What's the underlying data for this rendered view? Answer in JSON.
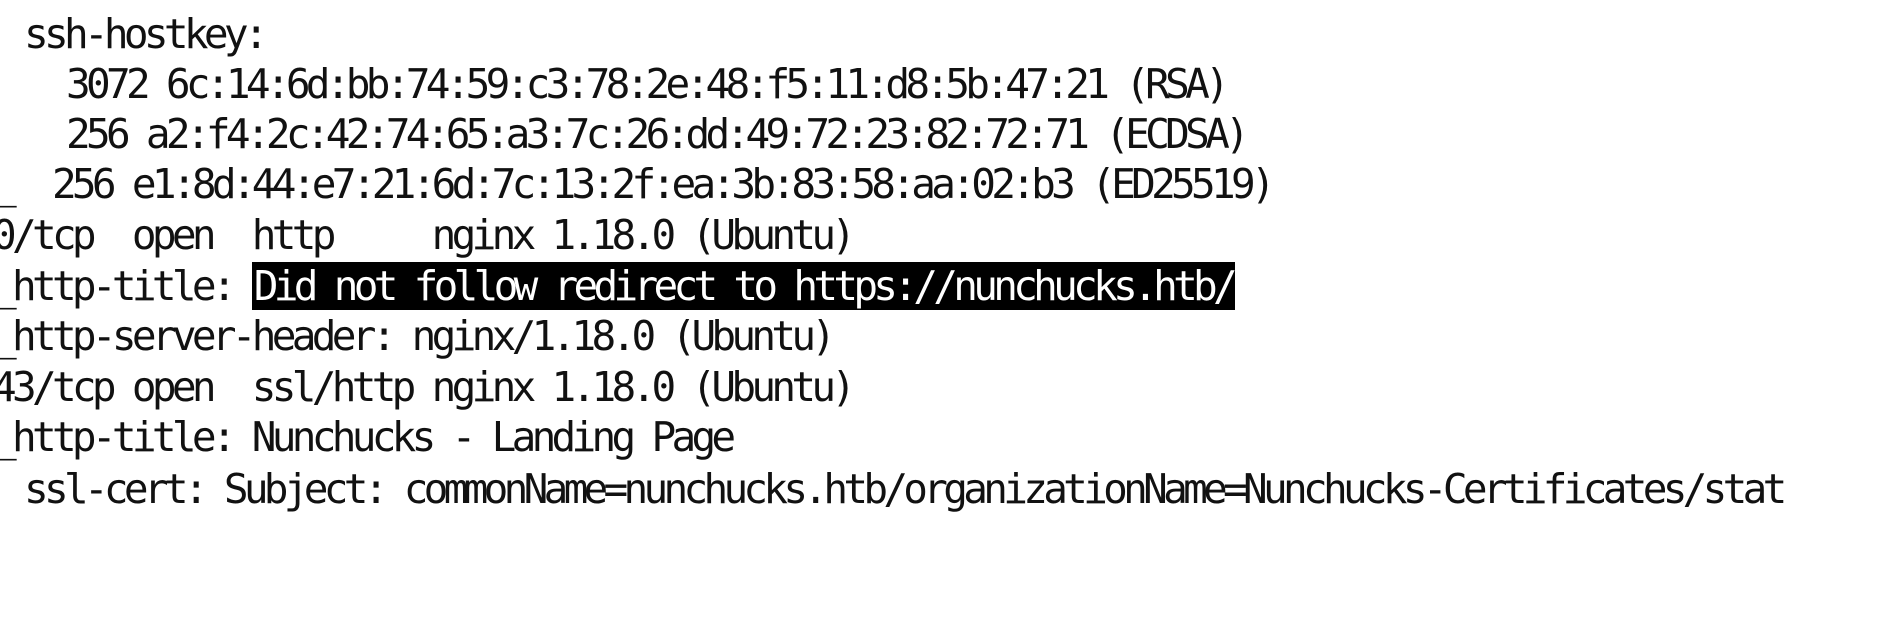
{
  "terminal": {
    "lines": [
      "ssh-hostkey:",
      "3072 6c:14:6d:bb:74:59:c3:78:2e:48:f5:11:d8:5b:47:21 (RSA)",
      "256 a2:f4:2c:42:74:65:a3:7c:26:dd:49:72:23:82:72:71 (ECDSA)",
      "_  256 e1:8d:44:e7:21:6d:7c:13:2f:ea:3b:83:58:aa:02:b3 (ED25519)",
      "0/tcp  open  http     nginx 1.18.0 (Ubuntu)",
      "_http-title: ",
      "_http-server-header: nginx/1.18.0 (Ubuntu)",
      "43/tcp open  ssl/http nginx 1.18.0 (Ubuntu)",
      "_http-title: Nunchucks - Landing Page",
      "ssl-cert: Subject: commonName=nunchucks.htb/organizationName=Nunchucks-Certificates/stat"
    ],
    "selected_text": "Did not follow redirect to https://nunchucks.htb/"
  }
}
